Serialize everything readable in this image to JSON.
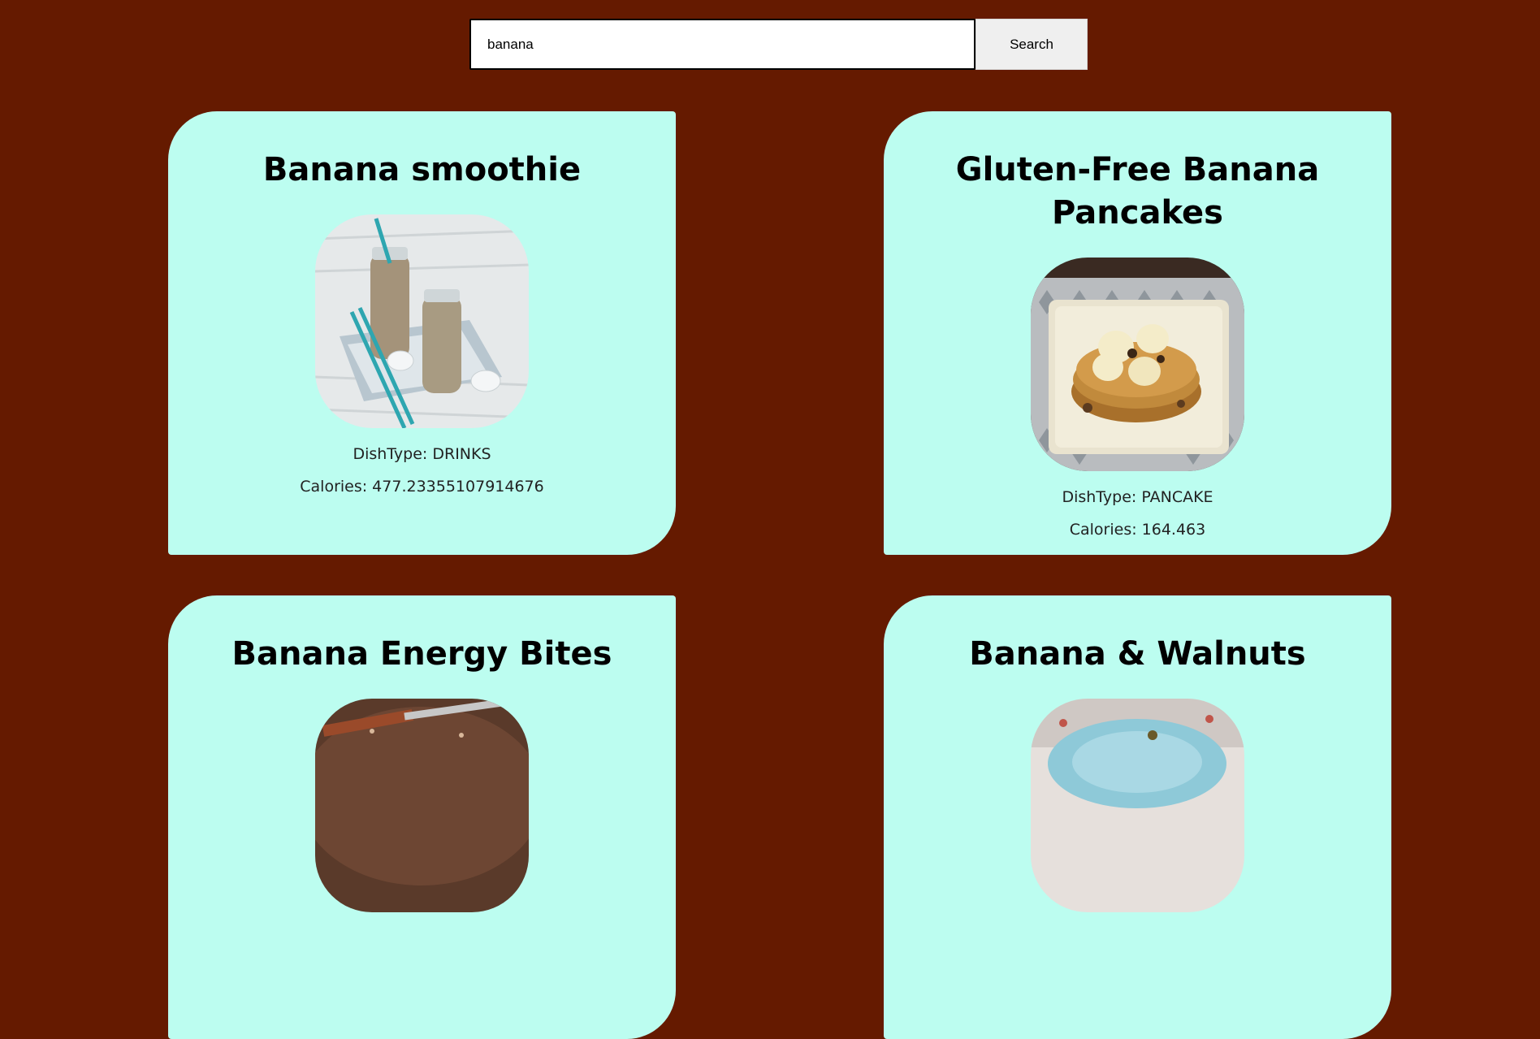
{
  "search": {
    "value": "banana",
    "button_label": "Search"
  },
  "recipes": [
    {
      "title": "Banana smoothie",
      "dish_type_text": "DishType: DRINKS",
      "calories_text": "Calories: 477.23355107914676"
    },
    {
      "title": "Gluten-Free Banana Pancakes",
      "dish_type_text": "DishType: PANCAKE",
      "calories_text": "Calories: 164.463"
    },
    {
      "title": "Banana Energy Bites"
    },
    {
      "title": "Banana & Walnuts"
    }
  ],
  "colors": {
    "page_background": "#651a00",
    "card_background": "#bcfdf0"
  }
}
